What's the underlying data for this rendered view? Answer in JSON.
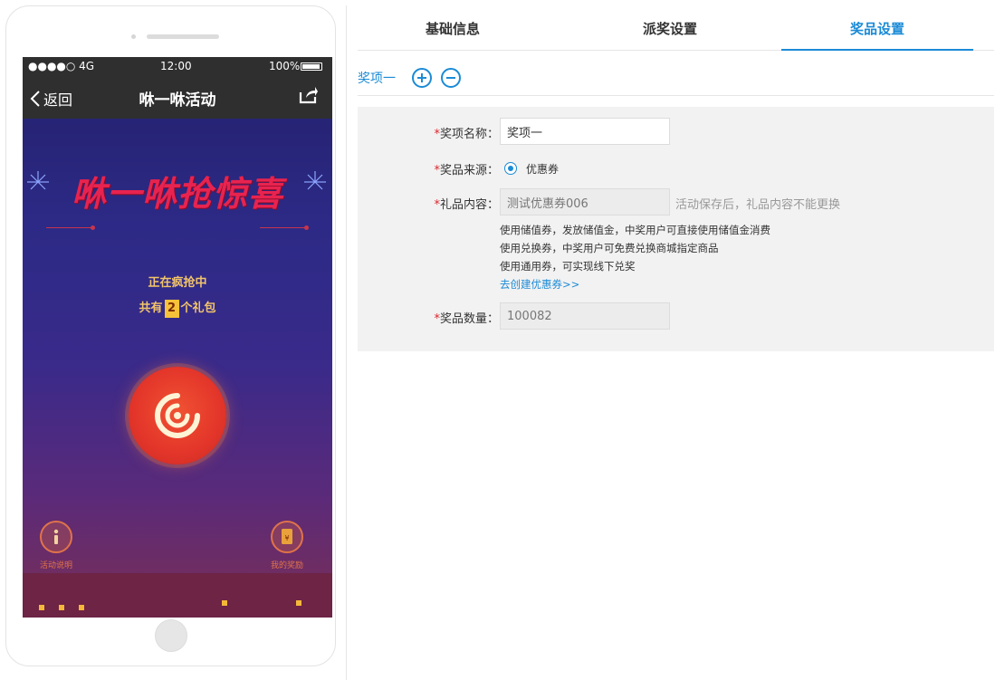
{
  "phone": {
    "status": {
      "signal": "●●●●○ 4G",
      "time": "12:00",
      "battery": "100%"
    },
    "nav": {
      "back_label": "返回",
      "title": "咻一咻活动"
    },
    "banner_text": "咻一咻抢惊喜",
    "status_text": "正在疯抢中",
    "gift": {
      "prefix": "共有",
      "count": "2",
      "suffix": "个礼包"
    },
    "left_button_label": "活动说明",
    "right_button_label": "我的奖励"
  },
  "tabs": [
    {
      "label": "基础信息",
      "active": false
    },
    {
      "label": "派奖设置",
      "active": false
    },
    {
      "label": "奖品设置",
      "active": true
    }
  ],
  "item_bar": {
    "label": "奖项一"
  },
  "form": {
    "name": {
      "label": "奖项名称：",
      "value": "奖项一"
    },
    "source": {
      "label": "奖品来源：",
      "option": "优惠券"
    },
    "content": {
      "label": "礼品内容：",
      "value": "测试优惠券006",
      "hint": "活动保存后，礼品内容不能更换",
      "descriptions": [
        "使用储值券，发放储值金，中奖用户可直接使用储值金消费",
        "使用兑换券，中奖用户可免费兑换商城指定商品",
        "使用通用券，可实现线下兑奖"
      ],
      "create_link": "去创建优惠券>>"
    },
    "quantity": {
      "label": "奖品数量：",
      "value": "100082"
    },
    "required_mark": "*"
  },
  "colors": {
    "accent": "#1b8bd6",
    "required": "#d9262b",
    "phone_bg_top": "#23206b"
  }
}
